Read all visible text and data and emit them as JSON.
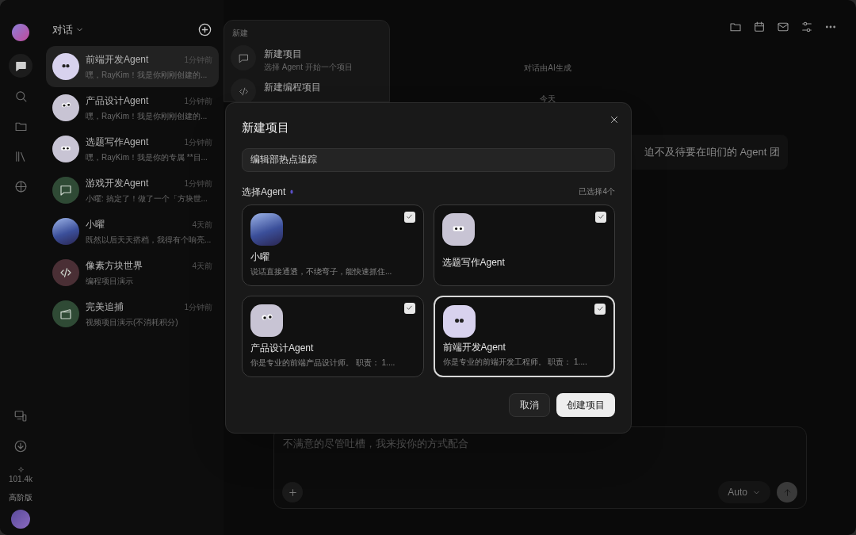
{
  "rail": {
    "top_icons": [
      {
        "kind": "chat",
        "selected": true
      },
      {
        "kind": "search",
        "selected": false
      },
      {
        "kind": "folder",
        "selected": false
      },
      {
        "kind": "library",
        "selected": false
      },
      {
        "kind": "globe",
        "selected": false
      }
    ],
    "bottom_icons": [
      {
        "kind": "devices"
      },
      {
        "kind": "download"
      }
    ],
    "credits": "101.4k",
    "plan": "高阶版"
  },
  "conversations": {
    "header": "对话",
    "items": [
      {
        "title": "前端开发Agent",
        "time": "1分钟前",
        "preview": "嘿，RayKim！我是你刚刚创建的...",
        "kind": "eyes-dark",
        "selected": true
      },
      {
        "title": "产品设计Agent",
        "time": "1分钟前",
        "preview": "嘿，RayKim！我是你刚刚创建的...",
        "kind": "eyes-round",
        "selected": false
      },
      {
        "title": "选题写作Agent",
        "time": "1分钟前",
        "preview": "嘿，RayKim！我是你的专属 **目...",
        "kind": "eyes-small",
        "selected": false
      },
      {
        "title": "游戏开发Agent",
        "time": "1分钟前",
        "preview": "小曜: 搞定了！做了一个「方块世...",
        "kind": "chat",
        "selected": false
      },
      {
        "title": "小曜",
        "time": "4天前",
        "preview": "既然以后天天搭档，我得有个响亮...",
        "kind": "photo",
        "selected": false
      },
      {
        "title": "像素方块世界",
        "time": "4天前",
        "preview": "编程项目演示",
        "kind": "code",
        "selected": false
      },
      {
        "title": "完美追捕",
        "time": "1分钟前",
        "preview": "视频项目演示(不消耗积分)",
        "kind": "clapper",
        "selected": false
      }
    ]
  },
  "new_menu": {
    "heading": "新建",
    "items": [
      {
        "title": "新建项目",
        "subtitle": "选择 Agent 开始一个项目",
        "kind": "chat"
      },
      {
        "title": "新建编程项目",
        "kind": "code"
      }
    ]
  },
  "main": {
    "notice": "对话由AI生成",
    "date": "今天",
    "message": "迫不及待要在咱们的 Agent 团",
    "input": {
      "placeholder": "不满意的尽管吐槽，我来按你的方式配合"
    },
    "model": "Auto"
  },
  "dialog": {
    "title": "新建项目",
    "name_value": "编辑部热点追踪",
    "section_label": "选择Agent",
    "selected_count": "已选择4个",
    "agents": [
      {
        "name": "小曜",
        "description": "说话直接通透，不绕弯子，能快速抓住...",
        "kind": "photo",
        "checked": true,
        "selected": false
      },
      {
        "name": "选题写作Agent",
        "kind": "eyes-small",
        "checked": true,
        "selected": false
      },
      {
        "name": "产品设计Agent",
        "description": "你是专业的前端产品设计师。 职责： 1....",
        "kind": "eyes-round",
        "checked": true,
        "selected": false
      },
      {
        "name": "前端开发Agent",
        "description": "你是专业的前端开发工程师。 职责： 1....",
        "kind": "eyes-dark",
        "checked": true,
        "selected": true
      }
    ],
    "cancel": "取消",
    "create": "创建项目"
  }
}
